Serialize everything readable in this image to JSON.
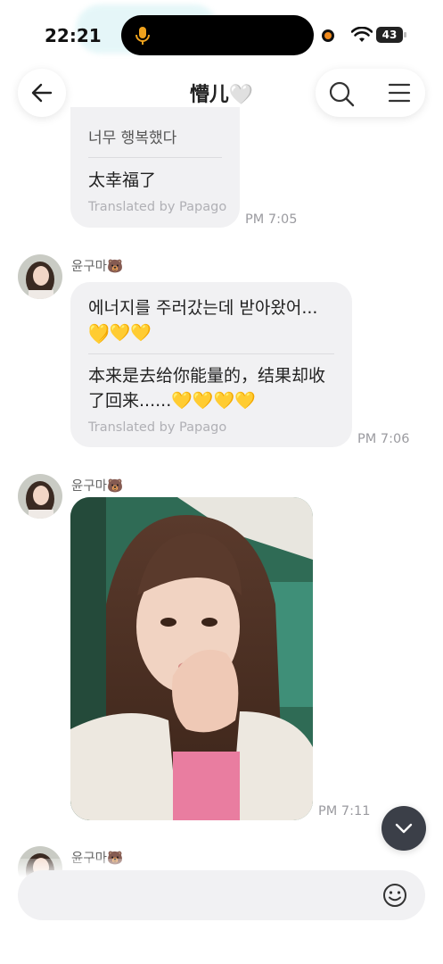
{
  "status_bar": {
    "time": "22:21",
    "battery": "43"
  },
  "header": {
    "title": "懵儿🤍"
  },
  "messages": [
    {
      "text_original": "너무 행복했다",
      "text_translated": "太幸福了",
      "credit": "Translated by Papago",
      "time": "PM 7:05"
    },
    {
      "sender": "윤구마🐻",
      "text_original_line1": "에너지를 주러갔는데 받아왔어...💛",
      "text_original_line2": "💛💛💛",
      "text_translated_line1": "本来是去给你能量的，结果却收",
      "text_translated_line2": "了回来......💛💛💛💛",
      "credit": "Translated by Papago",
      "time": "PM 7:06"
    },
    {
      "sender": "윤구마🐻",
      "type": "photo",
      "time": "PM 7:11"
    },
    {
      "sender": "윤구마🐻"
    }
  ],
  "composer": {
    "placeholder": ""
  },
  "icons": {
    "back": "arrow-left-icon",
    "search": "search-icon",
    "menu": "menu-icon",
    "scroll": "chevron-down-icon",
    "emoji": "smiley-icon",
    "mic": "microphone-icon"
  },
  "colors": {
    "bubble": "#f1f1f3",
    "mic_active": "#f0a21d",
    "scroll_button": "#3b3f48"
  }
}
